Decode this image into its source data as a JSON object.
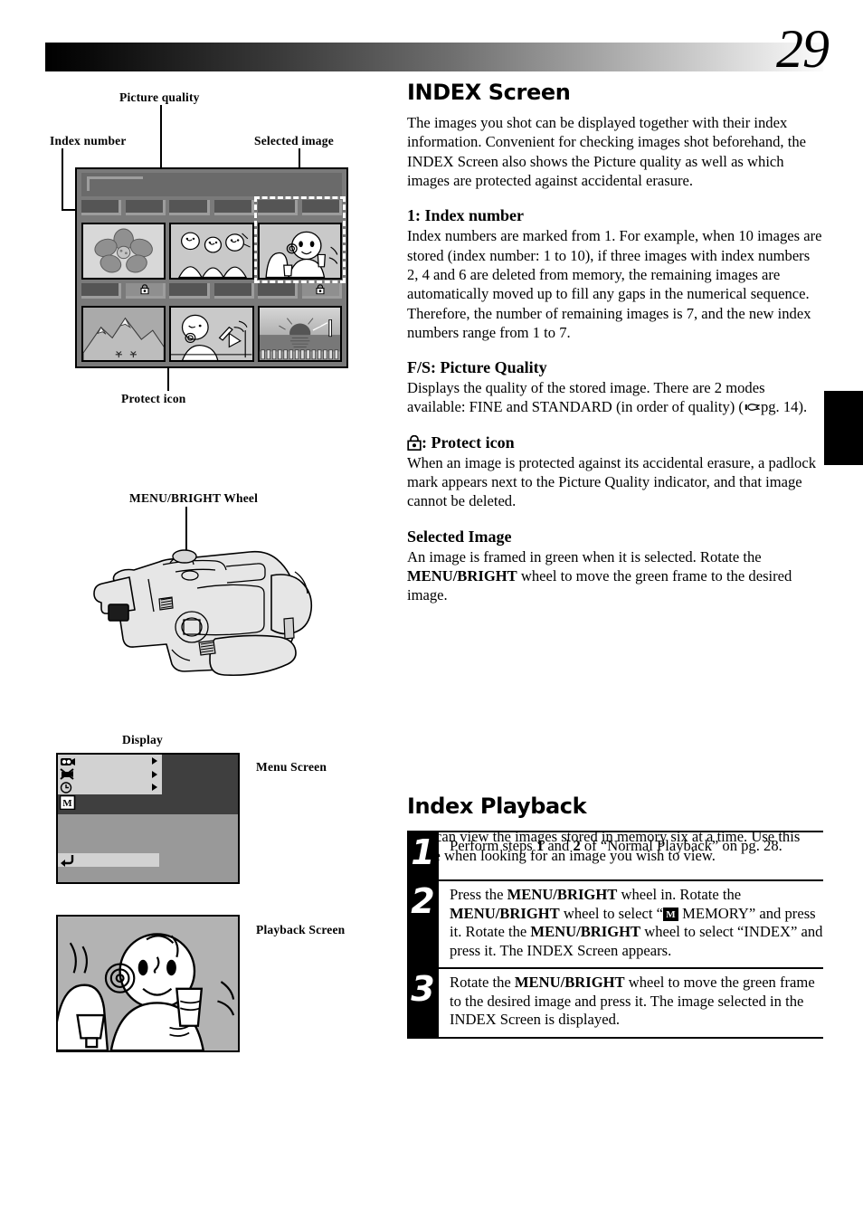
{
  "page": {
    "number": "29",
    "header_band": "gradient-bar"
  },
  "figures": {
    "index_screen": {
      "callouts": {
        "picture_quality": "Picture quality",
        "index_number": "Index number",
        "selected_image": "Selected image",
        "protect_icon": "Protect icon"
      },
      "cells": [
        {
          "tag_left": "index-number-tag",
          "tag_right": "picture-quality-tag",
          "protected": false,
          "selected": false,
          "thumb": "flower"
        },
        {
          "tag_left": "index-number-tag",
          "tag_right": "picture-quality-tag",
          "protected": false,
          "selected": false,
          "thumb": "three-people"
        },
        {
          "tag_left": "index-number-tag",
          "tag_right": "picture-quality-tag",
          "protected": false,
          "selected": true,
          "thumb": "woman-with-glass"
        },
        {
          "tag_left": "index-number-tag",
          "tag_right": "picture-quality-tag",
          "protected": true,
          "selected": false,
          "thumb": "mountain"
        },
        {
          "tag_left": "index-number-tag",
          "tag_right": "picture-quality-tag",
          "protected": false,
          "selected": false,
          "thumb": "woman-at-beach"
        },
        {
          "tag_left": "index-number-tag",
          "tag_right": "picture-quality-tag",
          "protected": true,
          "selected": false,
          "thumb": "sunset-pier"
        }
      ]
    },
    "camcorder": {
      "callout": "MENU/BRIGHT Wheel"
    },
    "display": {
      "title": "Display",
      "menu_screen_label": "Menu Screen",
      "playback_screen_label": "Playback Screen",
      "menu_rows": [
        {
          "icon": "camcorder-icon",
          "arrow": true
        },
        {
          "icon": "no-video-icon",
          "arrow": true
        },
        {
          "icon": "clock-icon",
          "arrow": true
        }
      ],
      "memory_icon": "M",
      "return_icon": "return-arrow-icon"
    }
  },
  "index_screen_section": {
    "title": "INDEX Screen",
    "intro": "The images you shot can be displayed together with their index information. Convenient for checking images shot beforehand, the INDEX Screen also shows the Picture quality as well as which images are protected against accidental erasure.",
    "subsections": [
      {
        "heading": "1: Index number",
        "body": "Index numbers are marked from 1. For example, when 10 images are stored (index number: 1 to 10), if three images with index numbers 2, 4 and 6 are deleted from memory, the remaining images are automatically moved up to fill any gaps in the numerical sequence. Therefore, the number of remaining images is 7, and the new index numbers range from 1 to 7."
      },
      {
        "heading": "F/S: Picture Quality",
        "body_pre": "Displays the quality of the stored image. There are 2 modes available: FINE and STANDARD (in order of quality) (",
        "body_ref": "pg. 14",
        "body_post": ")."
      },
      {
        "heading_icon": "padlock-icon",
        "heading": ": Protect icon",
        "body": "When an image is protected against its accidental erasure, a padlock mark appears next to the Picture Quality indicator, and that image cannot be deleted."
      },
      {
        "heading": "Selected Image",
        "body_pre": "An image is framed in green when it is selected. Rotate the ",
        "body_bold": "MENU/BRIGHT",
        "body_post": " wheel to move the green frame to the desired image."
      }
    ]
  },
  "index_playback_section": {
    "title": "Index Playback",
    "intro": "You can view the images stored in memory six at a time. Use this mode when looking for an image you wish to view.",
    "steps": [
      {
        "num": "1",
        "pre": "Perform steps ",
        "b1": "1",
        "mid": " and ",
        "b2": "2",
        "post": " of “Normal Playback” on pg. 28."
      },
      {
        "num": "2",
        "t1": "Press the ",
        "b1": "MENU/BRIGHT",
        "t2": " wheel in. Rotate the ",
        "b2": "MENU/BRIGHT",
        "t3": " wheel to select “",
        "icon": "M",
        "t4": " MEMORY” and press it. Rotate the ",
        "b3": "MENU/BRIGHT",
        "t5": " wheel to select “INDEX” and press it. The INDEX Screen appears."
      },
      {
        "num": "3",
        "t1": "Rotate the ",
        "b1": "MENU/BRIGHT",
        "t2": " wheel to move the green frame to the desired image and press it. The image selected in the INDEX Screen is displayed."
      }
    ]
  }
}
